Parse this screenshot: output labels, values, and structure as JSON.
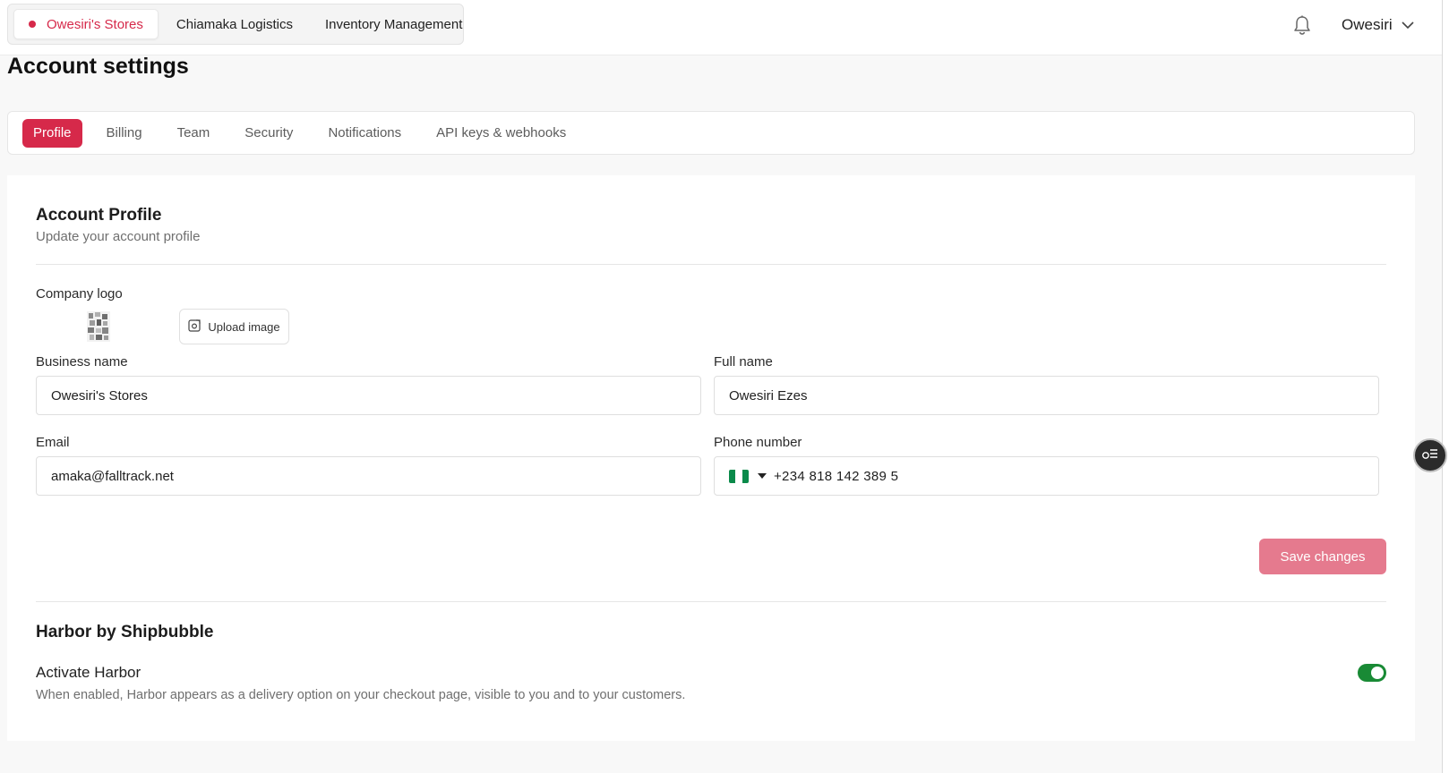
{
  "topbar": {
    "stores": [
      {
        "label": "Owesiri's Stores",
        "active": true
      },
      {
        "label": "Chiamaka Logistics",
        "active": false
      },
      {
        "label": "Inventory Management",
        "active": false
      }
    ],
    "user_name": "Owesiri",
    "icons": {
      "bell": "bell-icon",
      "chevron": "chevron-down-icon"
    }
  },
  "page": {
    "title": "Account settings"
  },
  "settings_tabs": [
    {
      "label": "Profile",
      "active": true
    },
    {
      "label": "Billing",
      "active": false
    },
    {
      "label": "Team",
      "active": false
    },
    {
      "label": "Security",
      "active": false
    },
    {
      "label": "Notifications",
      "active": false
    },
    {
      "label": "API keys & webhooks",
      "active": false
    }
  ],
  "profile": {
    "title": "Account Profile",
    "subtitle": "Update your account profile",
    "logo_label": "Company logo",
    "upload_label": "Upload image",
    "business_name_label": "Business name",
    "business_name_value": "Owesiri's Stores",
    "full_name_label": "Full name",
    "full_name_value": "Owesiri Ezes",
    "email_label": "Email",
    "email_value": "amaka@falltrack.net",
    "phone_label": "Phone number",
    "phone_value": "+234 818 142 389 5",
    "phone_country_flag": "nigeria-flag-icon",
    "save_label": "Save changes"
  },
  "harbor": {
    "title": "Harbor by Shipbubble",
    "activate_label": "Activate Harbor",
    "activate_description": "When enabled, Harbor appears as a delivery option on your checkout page, visible to you and to your customers.",
    "enabled": true
  },
  "colors": {
    "accent": "#d6294a",
    "save_button": "#e57a8e",
    "toggle_on": "#198a35",
    "flag_green": "#0a8a4a"
  }
}
